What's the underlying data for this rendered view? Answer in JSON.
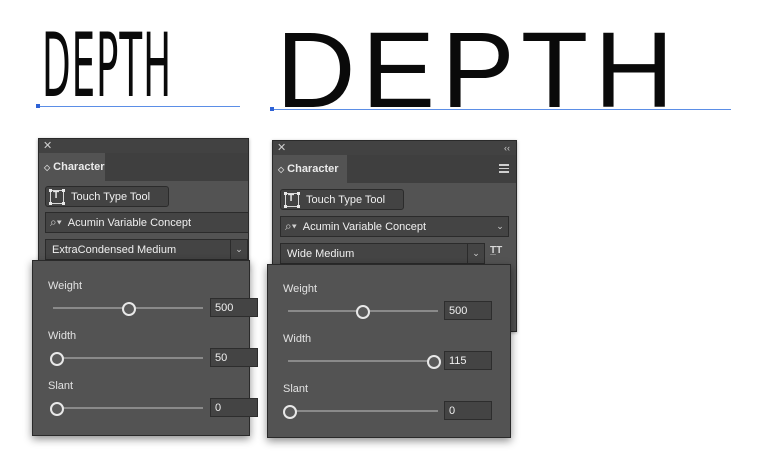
{
  "preview": {
    "word_left": "DEPTH",
    "word_right": "DEPTH"
  },
  "panel_left": {
    "tab_label": "Character",
    "touch_type_label": "Touch Type Tool",
    "font_family": "Acumin Variable Concept",
    "font_style": "ExtraCondensed Medium",
    "sliders": [
      {
        "label": "Weight",
        "value": "500",
        "fraction": 0.51
      },
      {
        "label": "Width",
        "value": "50",
        "fraction": 0.0
      },
      {
        "label": "Slant",
        "value": "0",
        "fraction": 0.0
      }
    ]
  },
  "panel_right": {
    "tab_label": "Character",
    "touch_type_label": "Touch Type Tool",
    "font_family": "Acumin Variable Concept",
    "font_style": "Wide Medium",
    "sliders": [
      {
        "label": "Weight",
        "value": "500",
        "fraction": 0.51
      },
      {
        "label": "Width",
        "value": "115",
        "fraction": 1.0
      },
      {
        "label": "Slant",
        "value": "0",
        "fraction": 0.0
      }
    ]
  },
  "icons": {
    "close": "close-icon",
    "collapse": "collapse-icon",
    "menu": "panel-menu-icon",
    "search": "font-search-icon",
    "dropdown": "chevron-down-icon",
    "variable_font": "variable-font-icon"
  }
}
